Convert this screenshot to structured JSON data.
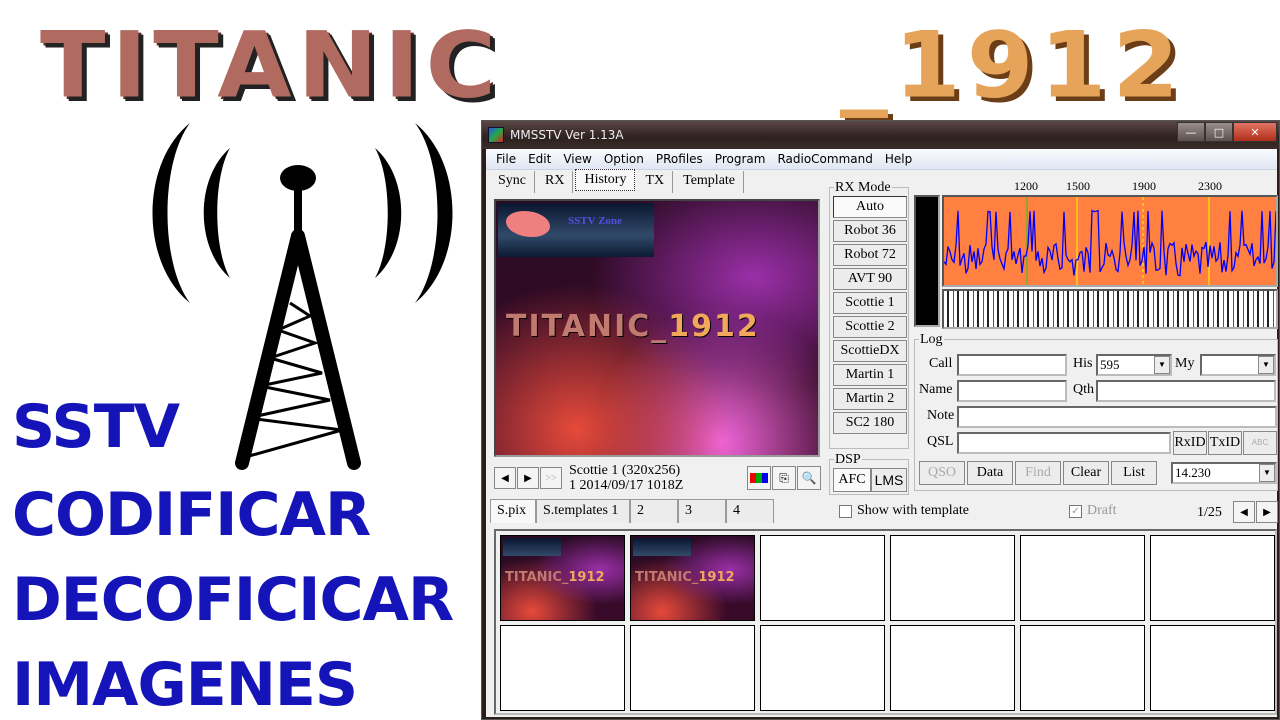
{
  "banner": {
    "title_part1": "TITANIC",
    "title_part2": "_1912"
  },
  "side_text": {
    "lines": [
      "SSTV",
      "CODIFICAR",
      "DECOFICICAR",
      "IMAGENES"
    ]
  },
  "window": {
    "title": "MMSSTV Ver 1.13A",
    "controls": {
      "minimize": "—",
      "maximize": "□",
      "close": "✕"
    },
    "menu": [
      "File",
      "Edit",
      "View",
      "Option",
      "PRofiles",
      "Program",
      "RadioCommand",
      "Help"
    ],
    "tabs": [
      {
        "label": "Sync"
      },
      {
        "label": "RX"
      },
      {
        "label": "History",
        "active": true
      },
      {
        "label": "TX"
      },
      {
        "label": "Template"
      }
    ],
    "rx_image": {
      "header_text": "SSTV Zone",
      "title_part1": "TITANIC_",
      "title_part2": "1912"
    },
    "nav": {
      "prev": "◀",
      "next": "▶",
      "skip": ">>"
    },
    "image_info": {
      "mode": "Scottie 1 (320x256)",
      "stamp": "1 2014/09/17 1018Z"
    },
    "image_tools": [
      "color-bars-icon",
      "copy-icon",
      "zoom-icon"
    ],
    "rx_mode": {
      "label": "RX Mode",
      "modes": [
        "Auto",
        "Robot 36",
        "Robot 72",
        "AVT 90",
        "Scottie 1",
        "Scottie 2",
        "ScottieDX",
        "Martin 1",
        "Martin 2",
        "SC2 180"
      ],
      "active": "Auto"
    },
    "dsp": {
      "label": "DSP",
      "buttons": [
        "AFC",
        "LMS"
      ],
      "active": "AFC"
    },
    "spectrum": {
      "freq_labels": [
        "1200",
        "1500",
        "1900",
        "2300"
      ],
      "bg_color": "#ff8040",
      "line_color": "#0000ff",
      "peak_color": "#ffff00"
    },
    "log": {
      "label": "Log",
      "call": {
        "label": "Call",
        "value": ""
      },
      "his": {
        "label": "His",
        "value": "595"
      },
      "my": {
        "label": "My",
        "value": ""
      },
      "name": {
        "label": "Name",
        "value": ""
      },
      "qth": {
        "label": "Qth",
        "value": ""
      },
      "note": {
        "label": "Note",
        "value": ""
      },
      "qsl": {
        "label": "QSL",
        "value": ""
      },
      "rxid": "RxID",
      "txid": "TxID",
      "abc": "ABC",
      "buttons": {
        "qso": "QSO",
        "data": "Data",
        "find": "Find",
        "clear": "Clear",
        "list": "List"
      },
      "frequency": "14.230"
    },
    "pic_tabs": [
      {
        "label": "S.pix",
        "active": true
      },
      {
        "label": "S.templates 1"
      },
      {
        "label": "2"
      },
      {
        "label": "3"
      },
      {
        "label": "4"
      }
    ],
    "show_with_template": {
      "label": "Show with template",
      "checked": false
    },
    "draft": {
      "label": "Draft",
      "checked": true
    },
    "page": "1/25",
    "thumbnails": {
      "filled": 2,
      "total": 12,
      "caption_part1": "TITANIC_",
      "caption_part2": "1912"
    }
  }
}
